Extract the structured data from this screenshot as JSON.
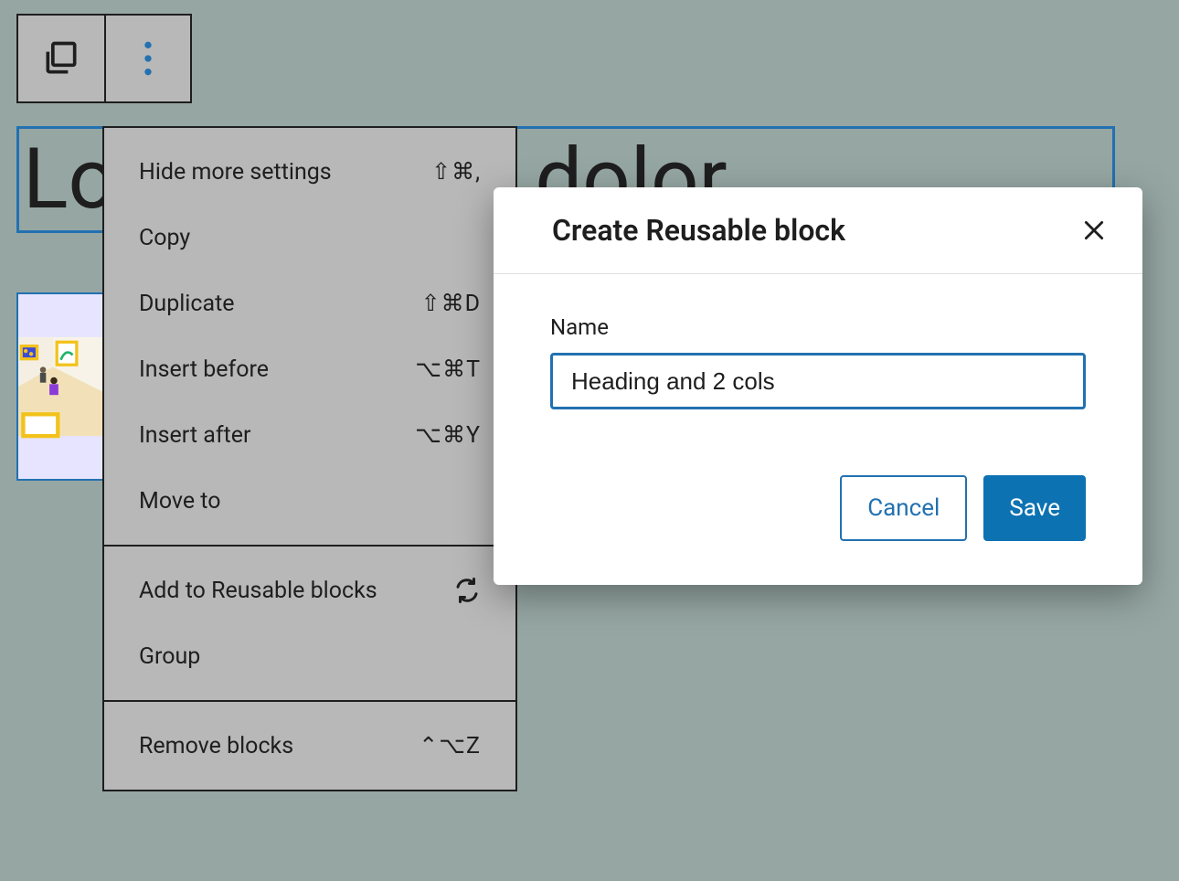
{
  "heading": "Lorem ipsum dolor",
  "menu": {
    "section1": {
      "hide_more_settings": {
        "label": "Hide more settings",
        "shortcut": "⇧⌘,"
      },
      "copy": {
        "label": "Copy",
        "shortcut": ""
      },
      "duplicate": {
        "label": "Duplicate",
        "shortcut": "⇧⌘D"
      },
      "insert_before": {
        "label": "Insert before",
        "shortcut": "⌥⌘T"
      },
      "insert_after": {
        "label": "Insert after",
        "shortcut": "⌥⌘Y"
      },
      "move_to": {
        "label": "Move to",
        "shortcut": ""
      }
    },
    "section2": {
      "add_to_reusable": {
        "label": "Add to Reusable blocks"
      },
      "group": {
        "label": "Group"
      }
    },
    "section3": {
      "remove_blocks": {
        "label": "Remove blocks",
        "shortcut": "⌃⌥Z"
      }
    }
  },
  "modal": {
    "title": "Create Reusable block",
    "name_label": "Name",
    "name_value": "Heading and 2 cols",
    "cancel_label": "Cancel",
    "save_label": "Save"
  }
}
